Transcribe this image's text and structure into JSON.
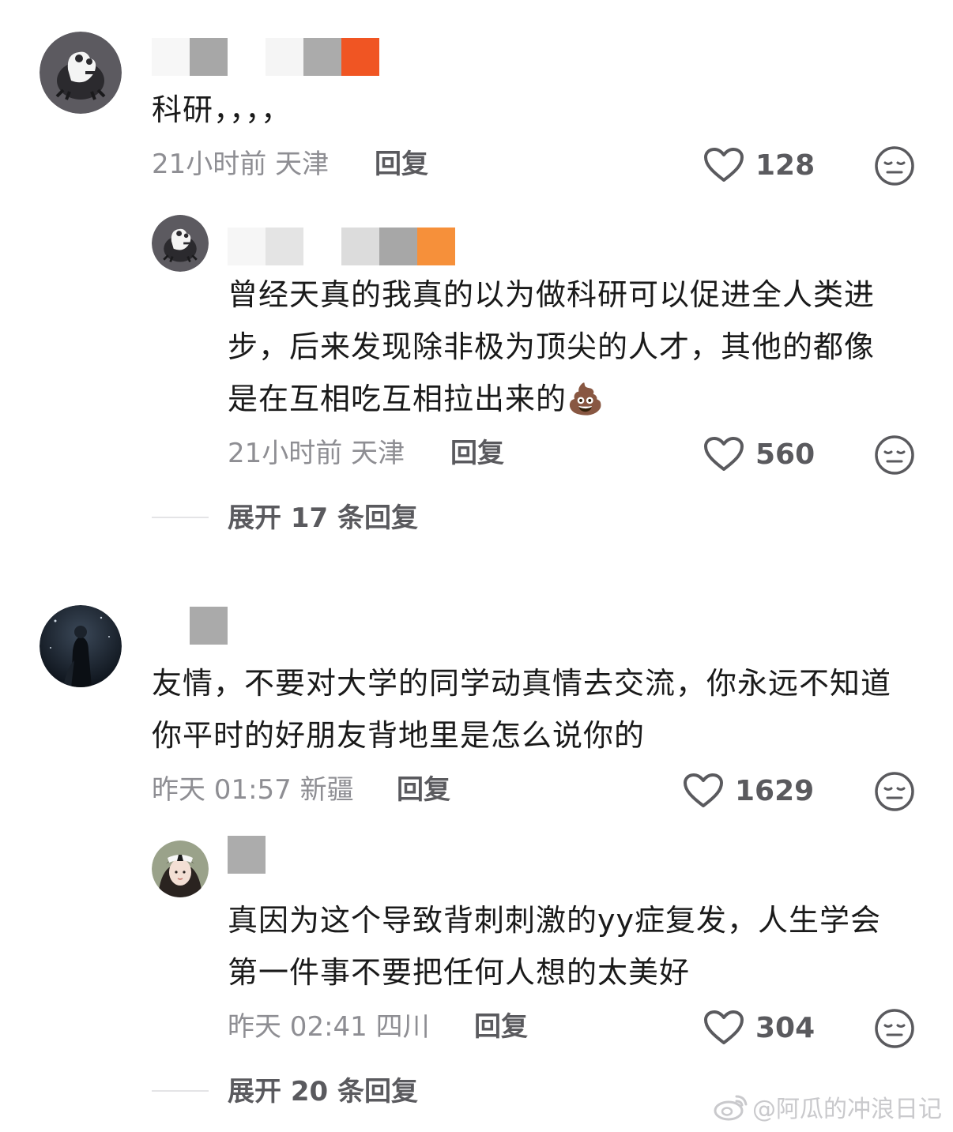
{
  "comments": [
    {
      "text": "科研，，，，",
      "time": "21小时前",
      "location": "天津",
      "reply_label": "回复",
      "likes": "128",
      "name_colors": [
        "#f7f7f7",
        "#a7a7a7",
        "#ffffff",
        "#f5f5f5",
        "#ababab",
        "#f05523"
      ],
      "replies": [
        {
          "text": "曾经天真的我真的以为做科研可以促进全人类进步，后来发现除非极为顶尖的人才，其他的都像是在互相吃互相拉出来的💩",
          "time": "21小时前",
          "location": "天津",
          "reply_label": "回复",
          "likes": "560",
          "name_colors": [
            "#f6f6f6",
            "#e4e4e4",
            "#ffffff",
            "#dcdcdc",
            "#a7a7a7",
            "#f6903a"
          ]
        }
      ],
      "expand_label": "展开 17 条回复"
    },
    {
      "text": "友情，不要对大学的同学动真情去交流，你永远不知道你平时的好朋友背地里是怎么说你的",
      "time": "昨天 01:57",
      "location": "新疆",
      "reply_label": "回复",
      "likes": "1629",
      "name_colors": [
        "#ffffff",
        "#aaaaaa"
      ],
      "replies": [
        {
          "text": "真因为这个导致背刺刺激的yy症复发，人生学会第一件事不要把任何人想的太美好",
          "time": "昨天 02:41",
          "location": "四川",
          "reply_label": "回复",
          "likes": "304",
          "name_colors": [
            "#acacac"
          ]
        }
      ],
      "expand_label": "展开 20 条回复"
    }
  ],
  "watermark": "@阿瓜的冲浪日记",
  "icons": {
    "like": "heart-outline-icon",
    "dislike": "neutral-face-icon",
    "watermark": "weibo-logo-icon"
  }
}
